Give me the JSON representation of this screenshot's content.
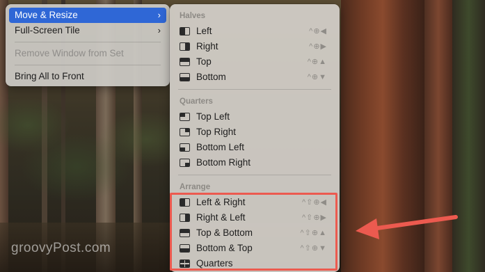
{
  "watermark": "groovyPost.com",
  "main_menu": {
    "items": [
      {
        "label": "Move & Resize",
        "chevron": "›"
      },
      {
        "label": "Full-Screen Tile",
        "chevron": "›"
      },
      {
        "label": "Remove Window from Set"
      },
      {
        "label": "Bring All to Front"
      }
    ]
  },
  "submenu": {
    "sections": {
      "halves": "Halves",
      "quarters": "Quarters",
      "arrange": "Arrange"
    },
    "halves": [
      {
        "label": "Left",
        "shortcut": "^⊕◀"
      },
      {
        "label": "Right",
        "shortcut": "^⊕▶"
      },
      {
        "label": "Top",
        "shortcut": "^⊕▲"
      },
      {
        "label": "Bottom",
        "shortcut": "^⊕▼"
      }
    ],
    "quarters": [
      {
        "label": "Top Left"
      },
      {
        "label": "Top Right"
      },
      {
        "label": "Bottom Left"
      },
      {
        "label": "Bottom Right"
      }
    ],
    "arrange": [
      {
        "label": "Left & Right",
        "shortcut": "^⇧⊕◀"
      },
      {
        "label": "Right & Left",
        "shortcut": "^⇧⊕▶"
      },
      {
        "label": "Top & Bottom",
        "shortcut": "^⇧⊕▲"
      },
      {
        "label": "Bottom & Top",
        "shortcut": "^⇧⊕▼"
      },
      {
        "label": "Quarters"
      }
    ]
  },
  "colors": {
    "highlight": "#2f67d6",
    "annotation": "#ec5a4f"
  }
}
